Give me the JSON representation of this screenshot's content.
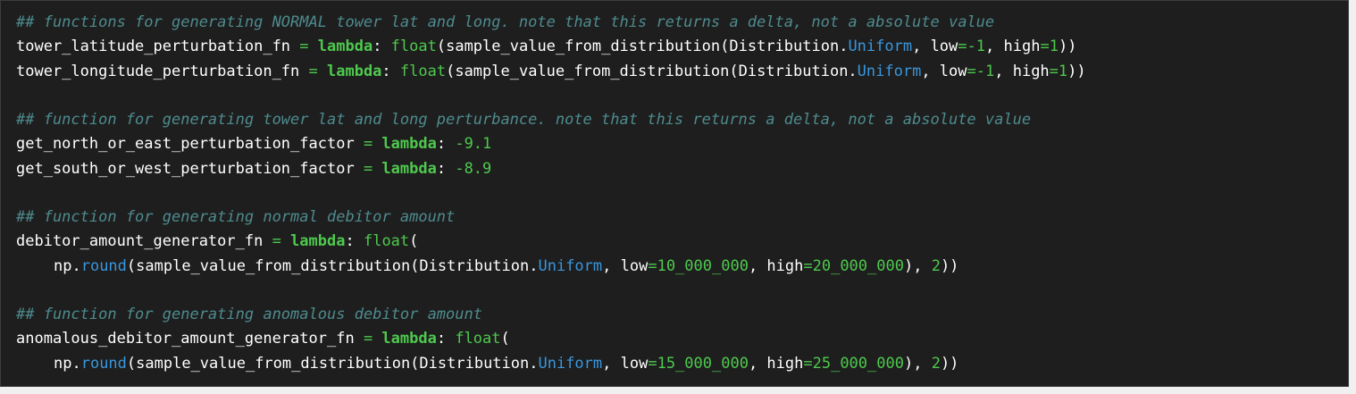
{
  "code": {
    "comment_1": "## functions for generating NORMAL tower lat and long. note that this returns a delta, not a absolute value",
    "line_1": {
      "name": "tower_latitude_perturbation_fn",
      "eq": " = ",
      "kw": "lambda",
      "colon": ": ",
      "float": "float",
      "open": "(sample_value_from_distribution(Distribution.",
      "attr": "Uniform",
      "mid": ", low",
      "eq2": "=",
      "low": "-1",
      "mid2": ", high",
      "eq3": "=",
      "high": "1",
      "close": "))"
    },
    "line_2": {
      "name": "tower_longitude_perturbation_fn",
      "eq": " = ",
      "kw": "lambda",
      "colon": ": ",
      "float": "float",
      "open": "(sample_value_from_distribution(Distribution.",
      "attr": "Uniform",
      "mid": ", low",
      "eq2": "=",
      "low": "-1",
      "mid2": ", high",
      "eq3": "=",
      "high": "1",
      "close": "))"
    },
    "comment_2": "## function for generating tower lat and long perturbance. note that this returns a delta, not a absolute value",
    "line_3": {
      "name": "get_north_or_east_perturbation_factor",
      "eq": " = ",
      "kw": "lambda",
      "colon": ": ",
      "value": "-9.1"
    },
    "line_4": {
      "name": "get_south_or_west_perturbation_factor",
      "eq": " = ",
      "kw": "lambda",
      "colon": ": ",
      "value": "-8.9"
    },
    "comment_3": "## function for generating normal debitor amount",
    "line_5": {
      "name": "debitor_amount_generator_fn",
      "eq": " = ",
      "kw": "lambda",
      "colon": ": ",
      "float": "float",
      "open": "("
    },
    "line_6": {
      "np": "np.",
      "round": "round",
      "open": "(sample_value_from_distribution(Distribution.",
      "attr": "Uniform",
      "mid": ", low",
      "eq2": "=",
      "low": "10_000_000",
      "mid2": ", high",
      "eq3": "=",
      "high": "20_000_000",
      "mid3": "), ",
      "digits": "2",
      "close": "))"
    },
    "comment_4": "## function for generating anomalous debitor amount",
    "line_7": {
      "name": "anomalous_debitor_amount_generator_fn",
      "eq": " = ",
      "kw": "lambda",
      "colon": ": ",
      "float": "float",
      "open": "("
    },
    "line_8": {
      "np": "np.",
      "round": "round",
      "open": "(sample_value_from_distribution(Distribution.",
      "attr": "Uniform",
      "mid": ", low",
      "eq2": "=",
      "low": "15_000_000",
      "mid2": ", high",
      "eq3": "=",
      "high": "25_000_000",
      "mid3": "), ",
      "digits": "2",
      "close": "))"
    }
  }
}
